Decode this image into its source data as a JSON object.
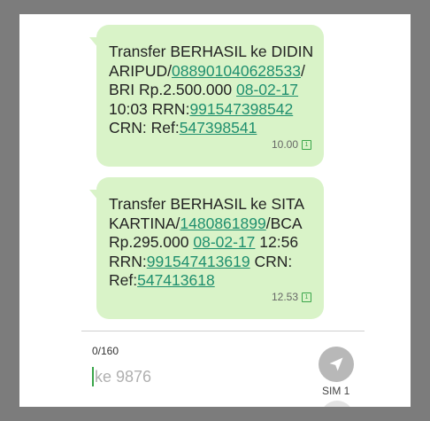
{
  "messages": [
    {
      "parts": [
        {
          "t": "Transfer BERHASIL ke DIDIN ARIPUD/",
          "link": false
        },
        {
          "t": "088901040628533",
          "link": true
        },
        {
          "t": "/ BRI Rp.2.500.000 ",
          "link": false
        },
        {
          "t": "08-02-17",
          "link": true
        },
        {
          "t": " 10:03 RRN:",
          "link": false
        },
        {
          "t": "991547398542",
          "link": true
        },
        {
          "t": " CRN:  Ref:",
          "link": false
        },
        {
          "t": "547398541",
          "link": true
        }
      ],
      "time": "10.00",
      "sim": "1"
    },
    {
      "parts": [
        {
          "t": "Transfer BERHASIL ke SITA KARTINA/",
          "link": false
        },
        {
          "t": "1480861899",
          "link": true
        },
        {
          "t": "/BCA Rp.295.000 ",
          "link": false
        },
        {
          "t": "08-02-17",
          "link": true
        },
        {
          "t": " 12:56 RRN:",
          "link": false
        },
        {
          "t": "991547413619",
          "link": true
        },
        {
          "t": " CRN: Ref:",
          "link": false
        },
        {
          "t": "547413618",
          "link": true
        }
      ],
      "time": "12.53",
      "sim": "1"
    }
  ],
  "composer": {
    "char_counter": "0/160",
    "placeholder": "ke 9876",
    "sim_label": "SIM 1",
    "send_icon": "send-icon"
  },
  "colors": {
    "bubble": "#d9f3c8",
    "link": "#1f8f6e",
    "accent": "#3aa54a"
  }
}
